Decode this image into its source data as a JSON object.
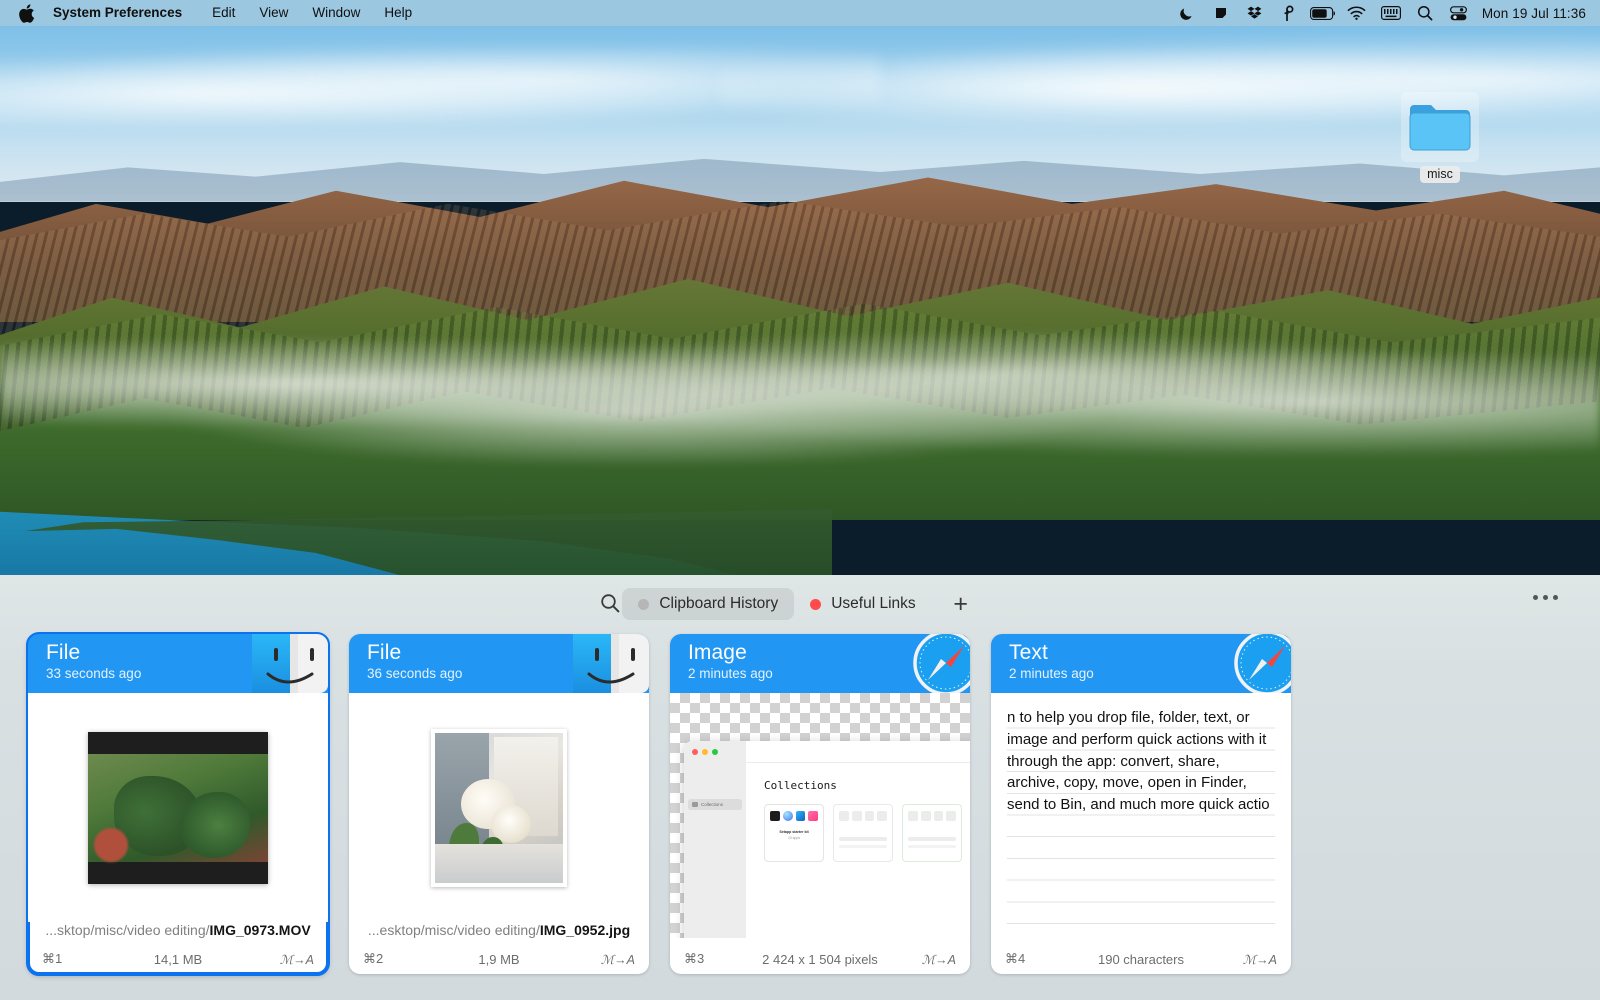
{
  "menubar": {
    "apple_icon": "apple-logo",
    "items": [
      {
        "label": "System Preferences",
        "bold": true
      },
      {
        "label": "Edit"
      },
      {
        "label": "View"
      },
      {
        "label": "Window"
      },
      {
        "label": "Help"
      }
    ],
    "status_icons": [
      "moon-icon",
      "shape-icon",
      "dropbox-icon",
      "proxyman-icon",
      "battery-icon",
      "wifi-icon",
      "keyboard-icon",
      "search-icon",
      "control-center-icon"
    ],
    "clock": "Mon 19 Jul  11:36"
  },
  "desktop": {
    "icon": {
      "name": "misc",
      "type": "folder",
      "selected": true
    }
  },
  "app": {
    "toolbar": {
      "search_icon": "search-icon",
      "tabs": [
        {
          "label": "Clipboard History",
          "dot_color": "#b6b6b6",
          "active": true
        },
        {
          "label": "Useful Links",
          "dot_color": "#ff4b4b",
          "active": false
        }
      ],
      "add_label": "+",
      "more_label": "more-options"
    },
    "cards": [
      {
        "type": "File",
        "time": "33 seconds ago",
        "source_icon": "finder-icon",
        "preview": "video-thumbnail",
        "path_prefix": "...sktop/misc/video editing/",
        "path_file": "IMG_0973.MOV",
        "shortcut": "⌘1",
        "meta": "14,1 MB",
        "convert": "ℳ→A",
        "selected": true
      },
      {
        "type": "File",
        "time": "36 seconds ago",
        "source_icon": "finder-icon",
        "preview": "photo-thumbnail",
        "path_prefix": "...esktop/misc/video editing/",
        "path_file": "IMG_0952.jpg",
        "shortcut": "⌘2",
        "meta": "1,9 MB",
        "convert": "ℳ→A",
        "selected": false
      },
      {
        "type": "Image",
        "time": "2 minutes ago",
        "source_icon": "safari-icon",
        "preview": "screenshot-collections",
        "screenshot_title": "Collections",
        "sidebar_label": "Collections",
        "tile_title": "Setapp starter kit",
        "tile_sub": "10 apps",
        "path_prefix": "",
        "path_file": "",
        "shortcut": "⌘3",
        "meta": "2 424 x 1 504 pixels",
        "convert": "ℳ→A",
        "selected": false
      },
      {
        "type": "Text",
        "time": "2 minutes ago",
        "source_icon": "safari-icon",
        "text": "n to help you drop file, folder, text, or image and perform quick actions with it through the app: convert, share, archive, copy, move, open in Finder, send to Bin, and much more quick actio",
        "path_prefix": "",
        "path_file": "",
        "shortcut": "⌘4",
        "meta": "190 characters",
        "convert": "ℳ→A",
        "selected": false
      }
    ]
  },
  "colors": {
    "accent_blue": "#0b72f0",
    "card_header": "#2196f3",
    "menubar_bg": "#a8d6f0",
    "panel_bg": "#d9e0e2"
  }
}
